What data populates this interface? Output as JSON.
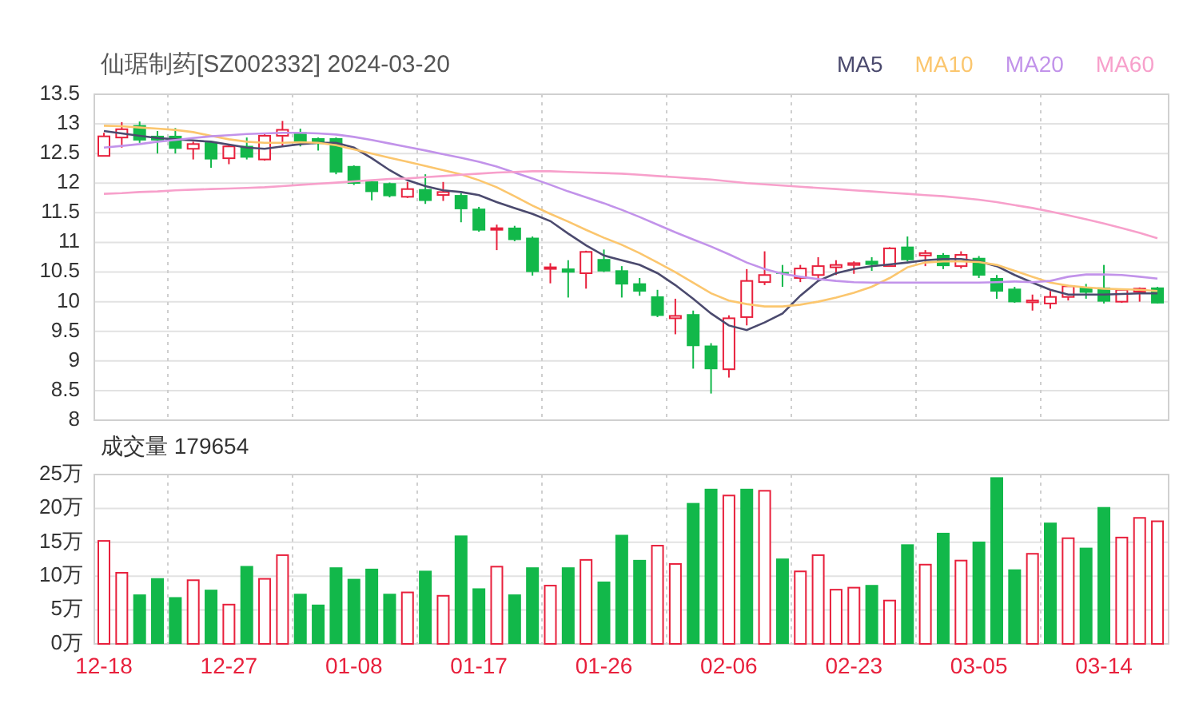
{
  "price_chart": {
    "title": "仙琚制药[SZ002332] 2024-03-20",
    "chart_data": {
      "type": "candlestick",
      "grid": true,
      "ylim": [
        8,
        13.5
      ],
      "yticks": [
        8,
        8.5,
        9,
        9.5,
        10,
        10.5,
        11,
        11.5,
        12,
        12.5,
        13,
        13.5
      ],
      "ohlc": [
        [
          12.46,
          12.85,
          12.45,
          12.79
        ],
        [
          12.77,
          13.03,
          12.6,
          12.91
        ],
        [
          12.98,
          13.04,
          12.68,
          12.72
        ],
        [
          12.8,
          12.88,
          12.5,
          12.72
        ],
        [
          12.8,
          12.93,
          12.5,
          12.58
        ],
        [
          12.58,
          12.7,
          12.4,
          12.66
        ],
        [
          12.69,
          12.7,
          12.26,
          12.4
        ],
        [
          12.42,
          12.64,
          12.32,
          12.62
        ],
        [
          12.63,
          12.77,
          12.4,
          12.43
        ],
        [
          12.4,
          12.85,
          12.38,
          12.8
        ],
        [
          12.8,
          13.05,
          12.62,
          12.9
        ],
        [
          12.86,
          12.92,
          12.62,
          12.68
        ],
        [
          12.76,
          12.77,
          12.55,
          12.66
        ],
        [
          12.76,
          12.77,
          12.15,
          12.18
        ],
        [
          12.29,
          12.3,
          11.97,
          11.99
        ],
        [
          12.03,
          12.04,
          11.71,
          11.85
        ],
        [
          12.0,
          12.01,
          11.76,
          11.78
        ],
        [
          11.77,
          12.02,
          11.75,
          11.9
        ],
        [
          11.9,
          12.15,
          11.65,
          11.7
        ],
        [
          11.8,
          12.02,
          11.7,
          11.85
        ],
        [
          11.8,
          11.83,
          11.34,
          11.56
        ],
        [
          11.57,
          11.6,
          11.18,
          11.2
        ],
        [
          11.22,
          11.3,
          10.87,
          11.24
        ],
        [
          11.25,
          11.28,
          11.02,
          11.04
        ],
        [
          11.08,
          11.1,
          10.44,
          10.5
        ],
        [
          10.56,
          10.65,
          10.31,
          10.58
        ],
        [
          10.56,
          10.7,
          10.07,
          10.49
        ],
        [
          10.48,
          10.86,
          10.22,
          10.84
        ],
        [
          10.72,
          10.88,
          10.5,
          10.51
        ],
        [
          10.53,
          10.6,
          10.07,
          10.29
        ],
        [
          10.31,
          10.4,
          10.1,
          10.17
        ],
        [
          10.09,
          10.2,
          9.74,
          9.76
        ],
        [
          9.72,
          10.05,
          9.45,
          9.76
        ],
        [
          9.79,
          9.85,
          8.87,
          9.25
        ],
        [
          9.26,
          9.3,
          8.45,
          8.86
        ],
        [
          8.86,
          9.77,
          8.72,
          9.72
        ],
        [
          9.74,
          10.55,
          9.6,
          10.35
        ],
        [
          10.33,
          10.85,
          10.28,
          10.45
        ],
        [
          10.5,
          10.62,
          10.25,
          10.47
        ],
        [
          10.4,
          10.62,
          10.33,
          10.56
        ],
        [
          10.45,
          10.75,
          10.35,
          10.6
        ],
        [
          10.58,
          10.7,
          10.45,
          10.62
        ],
        [
          10.62,
          10.68,
          10.47,
          10.65
        ],
        [
          10.69,
          10.75,
          10.52,
          10.62
        ],
        [
          10.6,
          10.92,
          10.6,
          10.9
        ],
        [
          10.93,
          11.1,
          10.68,
          10.7
        ],
        [
          10.78,
          10.87,
          10.6,
          10.82
        ],
        [
          10.79,
          10.82,
          10.55,
          10.6
        ],
        [
          10.6,
          10.85,
          10.56,
          10.79
        ],
        [
          10.74,
          10.77,
          10.4,
          10.44
        ],
        [
          10.4,
          10.45,
          10.05,
          10.17
        ],
        [
          10.22,
          10.25,
          9.98,
          9.99
        ],
        [
          9.99,
          10.12,
          9.85,
          10.02
        ],
        [
          9.97,
          10.18,
          9.88,
          10.08
        ],
        [
          10.08,
          10.28,
          10.02,
          10.26
        ],
        [
          10.24,
          10.3,
          10.05,
          10.15
        ],
        [
          10.24,
          10.62,
          9.97,
          10.0
        ],
        [
          10.0,
          10.22,
          9.98,
          10.2
        ],
        [
          10.17,
          10.24,
          10.0,
          10.22
        ],
        [
          10.24,
          10.25,
          9.97,
          9.97
        ]
      ],
      "series": [
        {
          "name": "MA5",
          "type": "line",
          "color": "#4b4a6e",
          "values": [
            12.88,
            12.84,
            12.8,
            12.76,
            12.74,
            12.72,
            12.7,
            12.65,
            12.6,
            12.58,
            12.62,
            12.66,
            12.68,
            12.68,
            12.6,
            12.42,
            12.22,
            12.05,
            11.95,
            11.88,
            11.85,
            11.8,
            11.68,
            11.58,
            11.48,
            11.36,
            11.15,
            10.95,
            10.78,
            10.7,
            10.62,
            10.48,
            10.28,
            10.05,
            9.8,
            9.6,
            9.52,
            9.65,
            9.8,
            10.1,
            10.35,
            10.48,
            10.55,
            10.6,
            10.63,
            10.66,
            10.7,
            10.72,
            10.72,
            10.68,
            10.6,
            10.45,
            10.32,
            10.2,
            10.12,
            10.12,
            10.12,
            10.13,
            10.14,
            10.14
          ]
        },
        {
          "name": "MA10",
          "type": "line",
          "color": "#fbc66e",
          "values": [
            12.97,
            12.96,
            12.94,
            12.92,
            12.9,
            12.86,
            12.8,
            12.74,
            12.7,
            12.68,
            12.68,
            12.69,
            12.68,
            12.64,
            12.57,
            12.5,
            12.43,
            12.36,
            12.29,
            12.22,
            12.15,
            12.05,
            11.93,
            11.78,
            11.62,
            11.48,
            11.35,
            11.21,
            11.08,
            10.96,
            10.82,
            10.66,
            10.5,
            10.32,
            10.14,
            10.02,
            9.96,
            9.92,
            9.92,
            9.95,
            10.0,
            10.07,
            10.15,
            10.25,
            10.4,
            10.58,
            10.66,
            10.68,
            10.68,
            10.67,
            10.62,
            10.52,
            10.42,
            10.32,
            10.27,
            10.24,
            10.22,
            10.21,
            10.2,
            10.18
          ]
        },
        {
          "name": "MA20",
          "type": "line",
          "color": "#c293ea",
          "values": [
            12.6,
            12.63,
            12.66,
            12.7,
            12.73,
            12.76,
            12.79,
            12.81,
            12.83,
            12.84,
            12.85,
            12.85,
            12.84,
            12.82,
            12.78,
            12.73,
            12.67,
            12.61,
            12.55,
            12.49,
            12.43,
            12.36,
            12.28,
            12.18,
            12.08,
            11.97,
            11.86,
            11.76,
            11.66,
            11.55,
            11.43,
            11.3,
            11.17,
            11.05,
            10.93,
            10.8,
            10.66,
            10.55,
            10.47,
            10.42,
            10.38,
            10.35,
            10.33,
            10.32,
            10.32,
            10.32,
            10.32,
            10.32,
            10.32,
            10.32,
            10.33,
            10.34,
            10.33,
            10.35,
            10.42,
            10.46,
            10.46,
            10.45,
            10.42,
            10.39
          ]
        },
        {
          "name": "MA60",
          "type": "line",
          "color": "#f7a0cb",
          "values": [
            11.82,
            11.83,
            11.85,
            11.86,
            11.88,
            11.89,
            11.9,
            11.91,
            11.92,
            11.93,
            11.95,
            11.97,
            11.99,
            12.01,
            12.03,
            12.05,
            12.07,
            12.08,
            12.1,
            12.12,
            12.14,
            12.16,
            12.18,
            12.19,
            12.2,
            12.2,
            12.19,
            12.18,
            12.17,
            12.16,
            12.14,
            12.12,
            12.1,
            12.08,
            12.06,
            12.03,
            12.0,
            11.98,
            11.96,
            11.94,
            11.92,
            11.9,
            11.88,
            11.86,
            11.84,
            11.82,
            11.8,
            11.78,
            11.75,
            11.72,
            11.68,
            11.63,
            11.58,
            11.52,
            11.46,
            11.39,
            11.32,
            11.24,
            11.16,
            11.07
          ]
        }
      ]
    }
  },
  "volume_chart": {
    "title": "成交量 179654",
    "chart_data": {
      "type": "bar",
      "grid": true,
      "ylim": [
        0,
        25
      ],
      "yticks": [
        {
          "value": 0,
          "label": "0万"
        },
        {
          "value": 5,
          "label": "5万"
        },
        {
          "value": 10,
          "label": "10万"
        },
        {
          "value": 15,
          "label": "15万"
        },
        {
          "value": 20,
          "label": "20万"
        },
        {
          "value": 25,
          "label": "25万"
        }
      ],
      "categories": [
        "12-18",
        null,
        null,
        null,
        null,
        null,
        null,
        "12-27",
        null,
        null,
        null,
        null,
        null,
        null,
        "01-08",
        null,
        null,
        null,
        null,
        null,
        null,
        "01-17",
        null,
        null,
        null,
        null,
        null,
        null,
        "01-26",
        null,
        null,
        null,
        null,
        null,
        null,
        "02-06",
        null,
        null,
        null,
        null,
        null,
        null,
        "02-23",
        null,
        null,
        null,
        null,
        null,
        null,
        "03-05",
        null,
        null,
        null,
        null,
        null,
        null,
        "03-14",
        null,
        null,
        null
      ],
      "values": [
        15.2,
        10.5,
        7.3,
        9.7,
        6.9,
        9.4,
        8,
        5.8,
        11.5,
        9.6,
        13.1,
        7.4,
        5.8,
        11.3,
        9.6,
        11.1,
        7.4,
        7.6,
        10.8,
        7.1,
        16,
        8.2,
        11.4,
        7.3,
        11.3,
        8.6,
        11.3,
        12.4,
        9.2,
        16.1,
        12.4,
        14.5,
        11.8,
        20.8,
        22.9,
        21.9,
        22.9,
        22.6,
        12.6,
        10.7,
        13.1,
        8,
        8.3,
        8.7,
        6.4,
        14.7,
        11.7,
        16.4,
        12.3,
        15.1,
        24.6,
        11,
        13.3,
        17.9,
        15.6,
        14.2,
        20.2,
        15.7,
        18.6,
        18.1
      ]
    },
    "rising": [
      true,
      true,
      false,
      false,
      false,
      true,
      false,
      true,
      false,
      true,
      true,
      false,
      false,
      false,
      false,
      false,
      false,
      true,
      false,
      true,
      false,
      false,
      true,
      false,
      false,
      true,
      false,
      true,
      false,
      false,
      false,
      true,
      true,
      false,
      false,
      true,
      false,
      true,
      false,
      true,
      true,
      true,
      true,
      false,
      true,
      false,
      true,
      false,
      true,
      false,
      false,
      false,
      true,
      false,
      true,
      false,
      false,
      true,
      true,
      true
    ]
  }
}
